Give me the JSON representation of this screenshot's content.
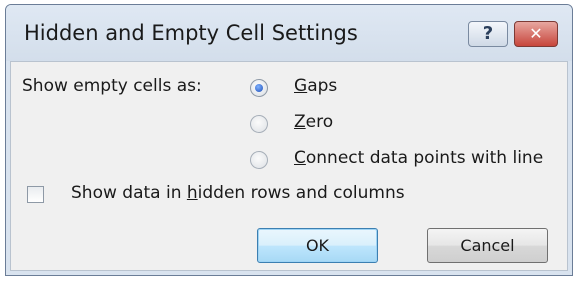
{
  "dialog": {
    "title": "Hidden and Empty Cell Settings",
    "help_label": "?",
    "close_label": "✕"
  },
  "empty_cells": {
    "label": "Show empty cells as:",
    "options": [
      {
        "access_key": "G",
        "rest": "aps",
        "selected": true
      },
      {
        "access_key": "Z",
        "rest": "ero",
        "selected": false
      },
      {
        "access_key": "C",
        "rest": "onnect data points with line",
        "selected": false
      }
    ]
  },
  "hidden_data": {
    "before": "Show data in ",
    "access_key": "h",
    "after": "idden rows and columns",
    "checked": false
  },
  "buttons": {
    "ok": "OK",
    "cancel": "Cancel"
  }
}
